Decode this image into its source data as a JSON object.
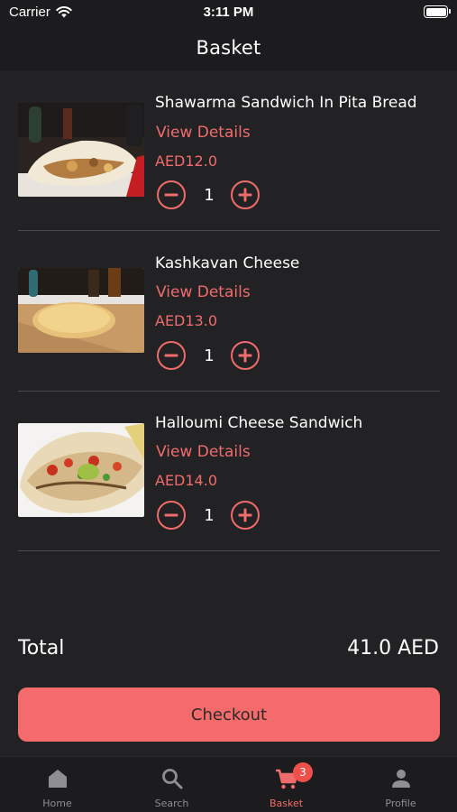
{
  "status_bar": {
    "carrier": "Carrier",
    "time": "3:11 PM"
  },
  "header": {
    "title": "Basket"
  },
  "basket": {
    "items": [
      {
        "name": "Shawarma Sandwich In Pita Bread",
        "details_label": "View Details",
        "price": "AED12.0",
        "quantity": "1"
      },
      {
        "name": "Kashkavan Cheese",
        "details_label": "View Details",
        "price": "AED13.0",
        "quantity": "1"
      },
      {
        "name": "Halloumi Cheese Sandwich",
        "details_label": "View Details",
        "price": "AED14.0",
        "quantity": "1"
      }
    ]
  },
  "summary": {
    "total_label": "Total",
    "total_value": "41.0 AED",
    "checkout_label": "Checkout"
  },
  "tab_bar": {
    "tabs": [
      {
        "label": "Home",
        "icon": "home-icon"
      },
      {
        "label": "Search",
        "icon": "search-icon"
      },
      {
        "label": "Basket",
        "icon": "cart-icon",
        "badge": "3",
        "active": true
      },
      {
        "label": "Profile",
        "icon": "person-icon"
      }
    ]
  },
  "colors": {
    "accent": "#f06c6c",
    "background": "#222224",
    "bar": "#1c1c1e"
  }
}
